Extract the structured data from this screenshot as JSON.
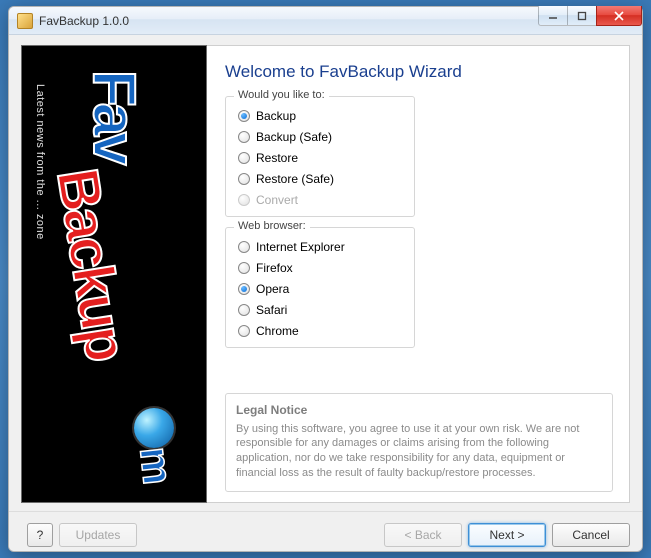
{
  "window": {
    "title": "FavBackup 1.0.0"
  },
  "sidebar": {
    "tagline": "Latest news from the ... zone",
    "logo_fav": "Fav",
    "logo_backup": "Backup",
    "logo_suffix": "m"
  },
  "main": {
    "heading": "Welcome to FavBackup Wizard",
    "action_group_label": "Would you like to:",
    "actions": [
      {
        "label": "Backup",
        "checked": true,
        "disabled": false
      },
      {
        "label": "Backup (Safe)",
        "checked": false,
        "disabled": false
      },
      {
        "label": "Restore",
        "checked": false,
        "disabled": false
      },
      {
        "label": "Restore (Safe)",
        "checked": false,
        "disabled": false
      },
      {
        "label": "Convert",
        "checked": false,
        "disabled": true
      }
    ],
    "browser_group_label": "Web browser:",
    "browsers": [
      {
        "label": "Internet Explorer",
        "checked": false
      },
      {
        "label": "Firefox",
        "checked": false
      },
      {
        "label": "Opera",
        "checked": true
      },
      {
        "label": "Safari",
        "checked": false
      },
      {
        "label": "Chrome",
        "checked": false
      }
    ],
    "legal": {
      "title": "Legal Notice",
      "body": "By using this software, you agree to use it at your own risk. We are not responsible for any damages or claims arising from the following application, nor do we take responsibility for any data, equipment or financial loss as the result of faulty backup/restore processes."
    }
  },
  "footer": {
    "help": "?",
    "updates": "Updates",
    "back": "< Back",
    "next": "Next >",
    "cancel": "Cancel"
  }
}
